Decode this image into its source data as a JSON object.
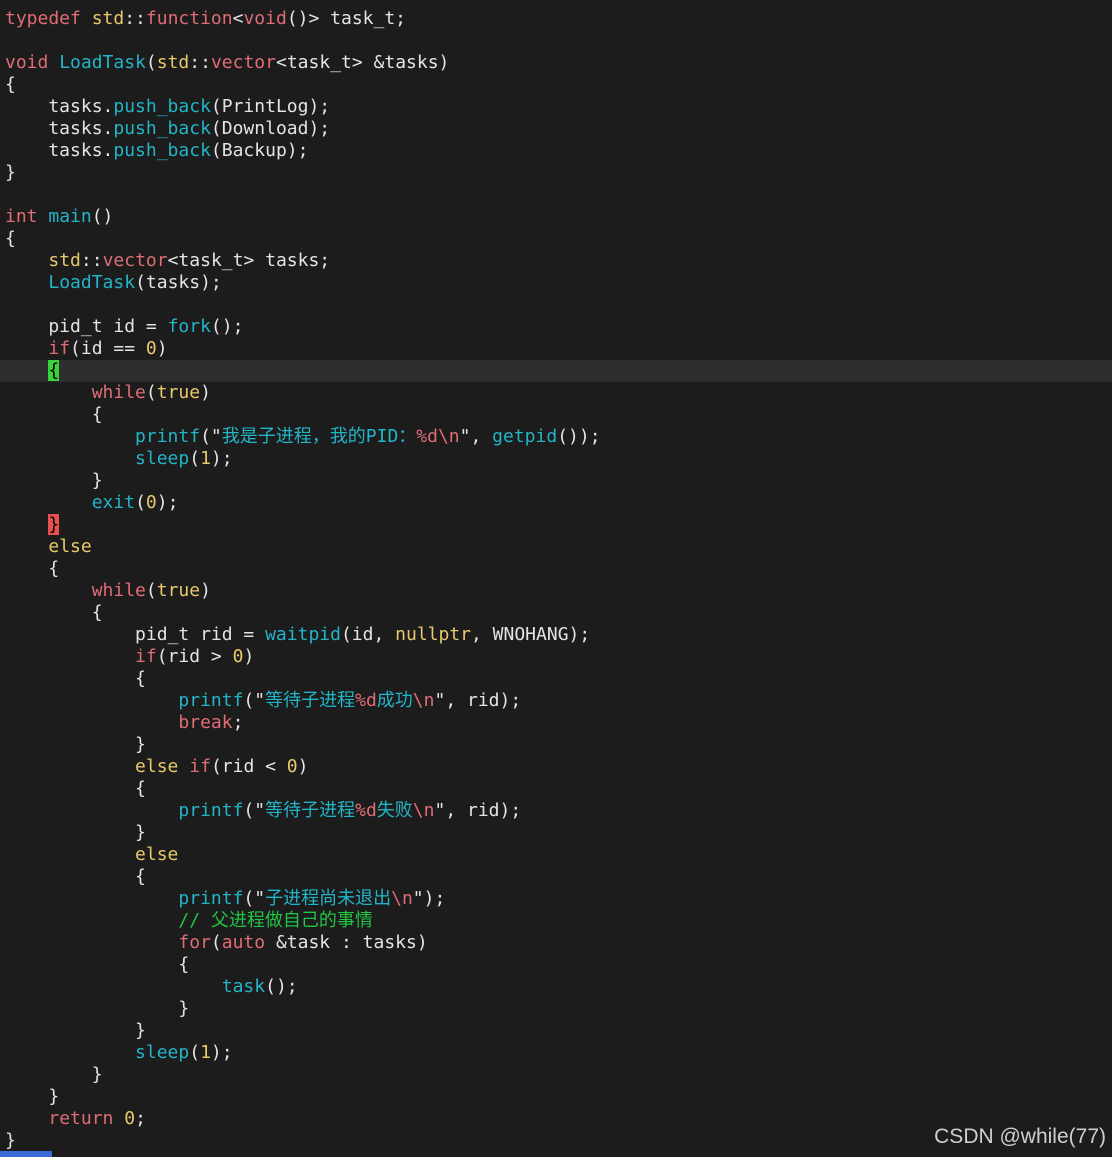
{
  "editor": {
    "cursorline_index": 16,
    "colors": {
      "background": "#1c1c1c",
      "cursorline": "#2e2e2e",
      "type": "#e06c75",
      "keyword": "#e06c75",
      "function": "#22b5c7",
      "namespace": "#e8c96b",
      "string": "#22b5c7",
      "comment": "#21c445",
      "plain": "#e4e4e4",
      "bracket_match_open": "#3ad13a",
      "bracket_match_close": "#e85050"
    },
    "lines": [
      [
        [
          "tok-type",
          "typedef"
        ],
        [
          "tok-plain",
          " "
        ],
        [
          "tok-ns",
          "std"
        ],
        [
          "tok-plain",
          "::"
        ],
        [
          "tok-type",
          "function"
        ],
        [
          "tok-plain",
          "<"
        ],
        [
          "tok-type",
          "void"
        ],
        [
          "tok-plain",
          "()> task_t;"
        ]
      ],
      [],
      [
        [
          "tok-type",
          "void"
        ],
        [
          "tok-plain",
          " "
        ],
        [
          "tok-fn",
          "LoadTask"
        ],
        [
          "tok-plain",
          "("
        ],
        [
          "tok-ns",
          "std"
        ],
        [
          "tok-plain",
          "::"
        ],
        [
          "tok-type",
          "vector"
        ],
        [
          "tok-plain",
          "<task_t> &tasks)"
        ]
      ],
      [
        [
          "tok-plain",
          "{"
        ]
      ],
      [
        [
          "tok-plain",
          "    tasks."
        ],
        [
          "tok-fn",
          "push_back"
        ],
        [
          "tok-plain",
          "(PrintLog);"
        ]
      ],
      [
        [
          "tok-plain",
          "    tasks."
        ],
        [
          "tok-fn",
          "push_back"
        ],
        [
          "tok-plain",
          "(Download);"
        ]
      ],
      [
        [
          "tok-plain",
          "    tasks."
        ],
        [
          "tok-fn",
          "push_back"
        ],
        [
          "tok-plain",
          "(Backup);"
        ]
      ],
      [
        [
          "tok-plain",
          "}"
        ]
      ],
      [],
      [
        [
          "tok-type",
          "int"
        ],
        [
          "tok-plain",
          " "
        ],
        [
          "tok-fn",
          "main"
        ],
        [
          "tok-plain",
          "()"
        ]
      ],
      [
        [
          "tok-plain",
          "{"
        ]
      ],
      [
        [
          "tok-plain",
          "    "
        ],
        [
          "tok-ns",
          "std"
        ],
        [
          "tok-plain",
          "::"
        ],
        [
          "tok-type",
          "vector"
        ],
        [
          "tok-plain",
          "<task_t> tasks;"
        ]
      ],
      [
        [
          "tok-plain",
          "    "
        ],
        [
          "tok-fn",
          "LoadTask"
        ],
        [
          "tok-plain",
          "(tasks);"
        ]
      ],
      [],
      [
        [
          "tok-plain",
          "    pid_t id = "
        ],
        [
          "tok-fn",
          "fork"
        ],
        [
          "tok-plain",
          "();"
        ]
      ],
      [
        [
          "tok-plain",
          "    "
        ],
        [
          "tok-kw",
          "if"
        ],
        [
          "tok-plain",
          "(id == "
        ],
        [
          "tok-num",
          "0"
        ],
        [
          "tok-plain",
          ")"
        ]
      ],
      [
        [
          "tok-plain",
          "    "
        ],
        [
          "tok-match-open",
          "{"
        ]
      ],
      [
        [
          "tok-plain",
          "        "
        ],
        [
          "tok-kw",
          "while"
        ],
        [
          "tok-plain",
          "("
        ],
        [
          "tok-const",
          "true"
        ],
        [
          "tok-plain",
          ")"
        ]
      ],
      [
        [
          "tok-plain",
          "        {"
        ]
      ],
      [
        [
          "tok-plain",
          "            "
        ],
        [
          "tok-fn",
          "printf"
        ],
        [
          "tok-plain",
          "(\""
        ],
        [
          "tok-str",
          "我是子进程，我的PID："
        ],
        [
          "tok-esc",
          "%d\\n"
        ],
        [
          "tok-plain",
          "\", "
        ],
        [
          "tok-fn",
          "getpid"
        ],
        [
          "tok-plain",
          "());"
        ]
      ],
      [
        [
          "tok-plain",
          "            "
        ],
        [
          "tok-fn",
          "sleep"
        ],
        [
          "tok-plain",
          "("
        ],
        [
          "tok-num",
          "1"
        ],
        [
          "tok-plain",
          ");"
        ]
      ],
      [
        [
          "tok-plain",
          "        }"
        ]
      ],
      [
        [
          "tok-plain",
          "        "
        ],
        [
          "tok-fn",
          "exit"
        ],
        [
          "tok-plain",
          "("
        ],
        [
          "tok-num",
          "0"
        ],
        [
          "tok-plain",
          ");"
        ]
      ],
      [
        [
          "tok-plain",
          "    "
        ],
        [
          "tok-match-close",
          "}"
        ]
      ],
      [
        [
          "tok-plain",
          "    "
        ],
        [
          "tok-const",
          "else"
        ]
      ],
      [
        [
          "tok-plain",
          "    {"
        ]
      ],
      [
        [
          "tok-plain",
          "        "
        ],
        [
          "tok-kw",
          "while"
        ],
        [
          "tok-plain",
          "("
        ],
        [
          "tok-const",
          "true"
        ],
        [
          "tok-plain",
          ")"
        ]
      ],
      [
        [
          "tok-plain",
          "        {"
        ]
      ],
      [
        [
          "tok-plain",
          "            pid_t rid = "
        ],
        [
          "tok-fn",
          "waitpid"
        ],
        [
          "tok-plain",
          "(id, "
        ],
        [
          "tok-const",
          "nullptr"
        ],
        [
          "tok-plain",
          ", WNOHANG);"
        ]
      ],
      [
        [
          "tok-plain",
          "            "
        ],
        [
          "tok-kw",
          "if"
        ],
        [
          "tok-plain",
          "(rid > "
        ],
        [
          "tok-num",
          "0"
        ],
        [
          "tok-plain",
          ")"
        ]
      ],
      [
        [
          "tok-plain",
          "            {"
        ]
      ],
      [
        [
          "tok-plain",
          "                "
        ],
        [
          "tok-fn",
          "printf"
        ],
        [
          "tok-plain",
          "(\""
        ],
        [
          "tok-str",
          "等待子进程"
        ],
        [
          "tok-esc",
          "%d"
        ],
        [
          "tok-str",
          "成功"
        ],
        [
          "tok-esc",
          "\\n"
        ],
        [
          "tok-plain",
          "\", rid);"
        ]
      ],
      [
        [
          "tok-plain",
          "                "
        ],
        [
          "tok-kw",
          "break"
        ],
        [
          "tok-plain",
          ";"
        ]
      ],
      [
        [
          "tok-plain",
          "            }"
        ]
      ],
      [
        [
          "tok-plain",
          "            "
        ],
        [
          "tok-const",
          "else"
        ],
        [
          "tok-plain",
          " "
        ],
        [
          "tok-kw",
          "if"
        ],
        [
          "tok-plain",
          "(rid < "
        ],
        [
          "tok-num",
          "0"
        ],
        [
          "tok-plain",
          ")"
        ]
      ],
      [
        [
          "tok-plain",
          "            {"
        ]
      ],
      [
        [
          "tok-plain",
          "                "
        ],
        [
          "tok-fn",
          "printf"
        ],
        [
          "tok-plain",
          "(\""
        ],
        [
          "tok-str",
          "等待子进程"
        ],
        [
          "tok-esc",
          "%d"
        ],
        [
          "tok-str",
          "失败"
        ],
        [
          "tok-esc",
          "\\n"
        ],
        [
          "tok-plain",
          "\", rid);"
        ]
      ],
      [
        [
          "tok-plain",
          "            }"
        ]
      ],
      [
        [
          "tok-plain",
          "            "
        ],
        [
          "tok-const",
          "else"
        ]
      ],
      [
        [
          "tok-plain",
          "            {"
        ]
      ],
      [
        [
          "tok-plain",
          "                "
        ],
        [
          "tok-fn",
          "printf"
        ],
        [
          "tok-plain",
          "(\""
        ],
        [
          "tok-str",
          "子进程尚未退出"
        ],
        [
          "tok-esc",
          "\\n"
        ],
        [
          "tok-plain",
          "\");"
        ]
      ],
      [
        [
          "tok-plain",
          "                "
        ],
        [
          "tok-comment",
          "// 父进程做自己的事情"
        ]
      ],
      [
        [
          "tok-plain",
          "                "
        ],
        [
          "tok-kw",
          "for"
        ],
        [
          "tok-plain",
          "("
        ],
        [
          "tok-type",
          "auto"
        ],
        [
          "tok-plain",
          " &task : tasks)"
        ]
      ],
      [
        [
          "tok-plain",
          "                {"
        ]
      ],
      [
        [
          "tok-plain",
          "                    "
        ],
        [
          "tok-fn",
          "task"
        ],
        [
          "tok-plain",
          "();"
        ]
      ],
      [
        [
          "tok-plain",
          "                }"
        ]
      ],
      [
        [
          "tok-plain",
          "            }"
        ]
      ],
      [
        [
          "tok-plain",
          "            "
        ],
        [
          "tok-fn",
          "sleep"
        ],
        [
          "tok-plain",
          "("
        ],
        [
          "tok-num",
          "1"
        ],
        [
          "tok-plain",
          ");"
        ]
      ],
      [
        [
          "tok-plain",
          "        }"
        ]
      ],
      [
        [
          "tok-plain",
          "    }"
        ]
      ],
      [
        [
          "tok-plain",
          "    "
        ],
        [
          "tok-kw",
          "return"
        ],
        [
          "tok-plain",
          " "
        ],
        [
          "tok-num",
          "0"
        ],
        [
          "tok-plain",
          ";"
        ]
      ],
      [
        [
          "tok-plain",
          "}"
        ]
      ]
    ]
  },
  "watermark": {
    "text": "CSDN @while(77)"
  }
}
